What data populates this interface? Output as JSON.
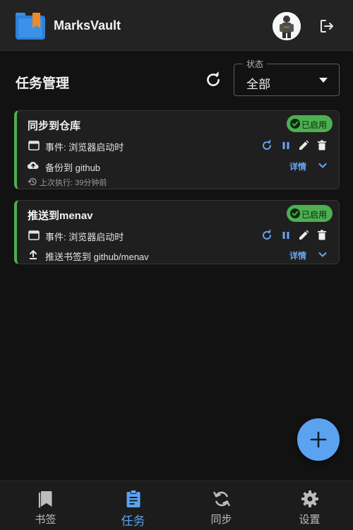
{
  "app": {
    "title": "MarksVault"
  },
  "header": {
    "title": "任务管理"
  },
  "status_filter": {
    "legend": "状态",
    "value": "全部"
  },
  "tasks": [
    {
      "title": "同步到仓库",
      "badge": "已启用",
      "trigger": "事件: 浏览器启动时",
      "action": "备份到 github",
      "detail_label": "详情",
      "last_run": "上次执行: 39分钟前"
    },
    {
      "title": "推送到menav",
      "badge": "已启用",
      "trigger": "事件: 浏览器启动时",
      "action": "推送书签到 github/menav",
      "detail_label": "详情"
    }
  ],
  "nav": [
    {
      "label": "书签",
      "icon": "bookmark-icon",
      "active": false
    },
    {
      "label": "任务",
      "icon": "clipboard-icon",
      "active": true
    },
    {
      "label": "同步",
      "icon": "sync-icon",
      "active": false
    },
    {
      "label": "设置",
      "icon": "gear-icon",
      "active": false
    }
  ],
  "colors": {
    "accent": "#5ba3f0",
    "enabled": "#4caf50",
    "background": "#121212",
    "appbar": "#232323"
  }
}
